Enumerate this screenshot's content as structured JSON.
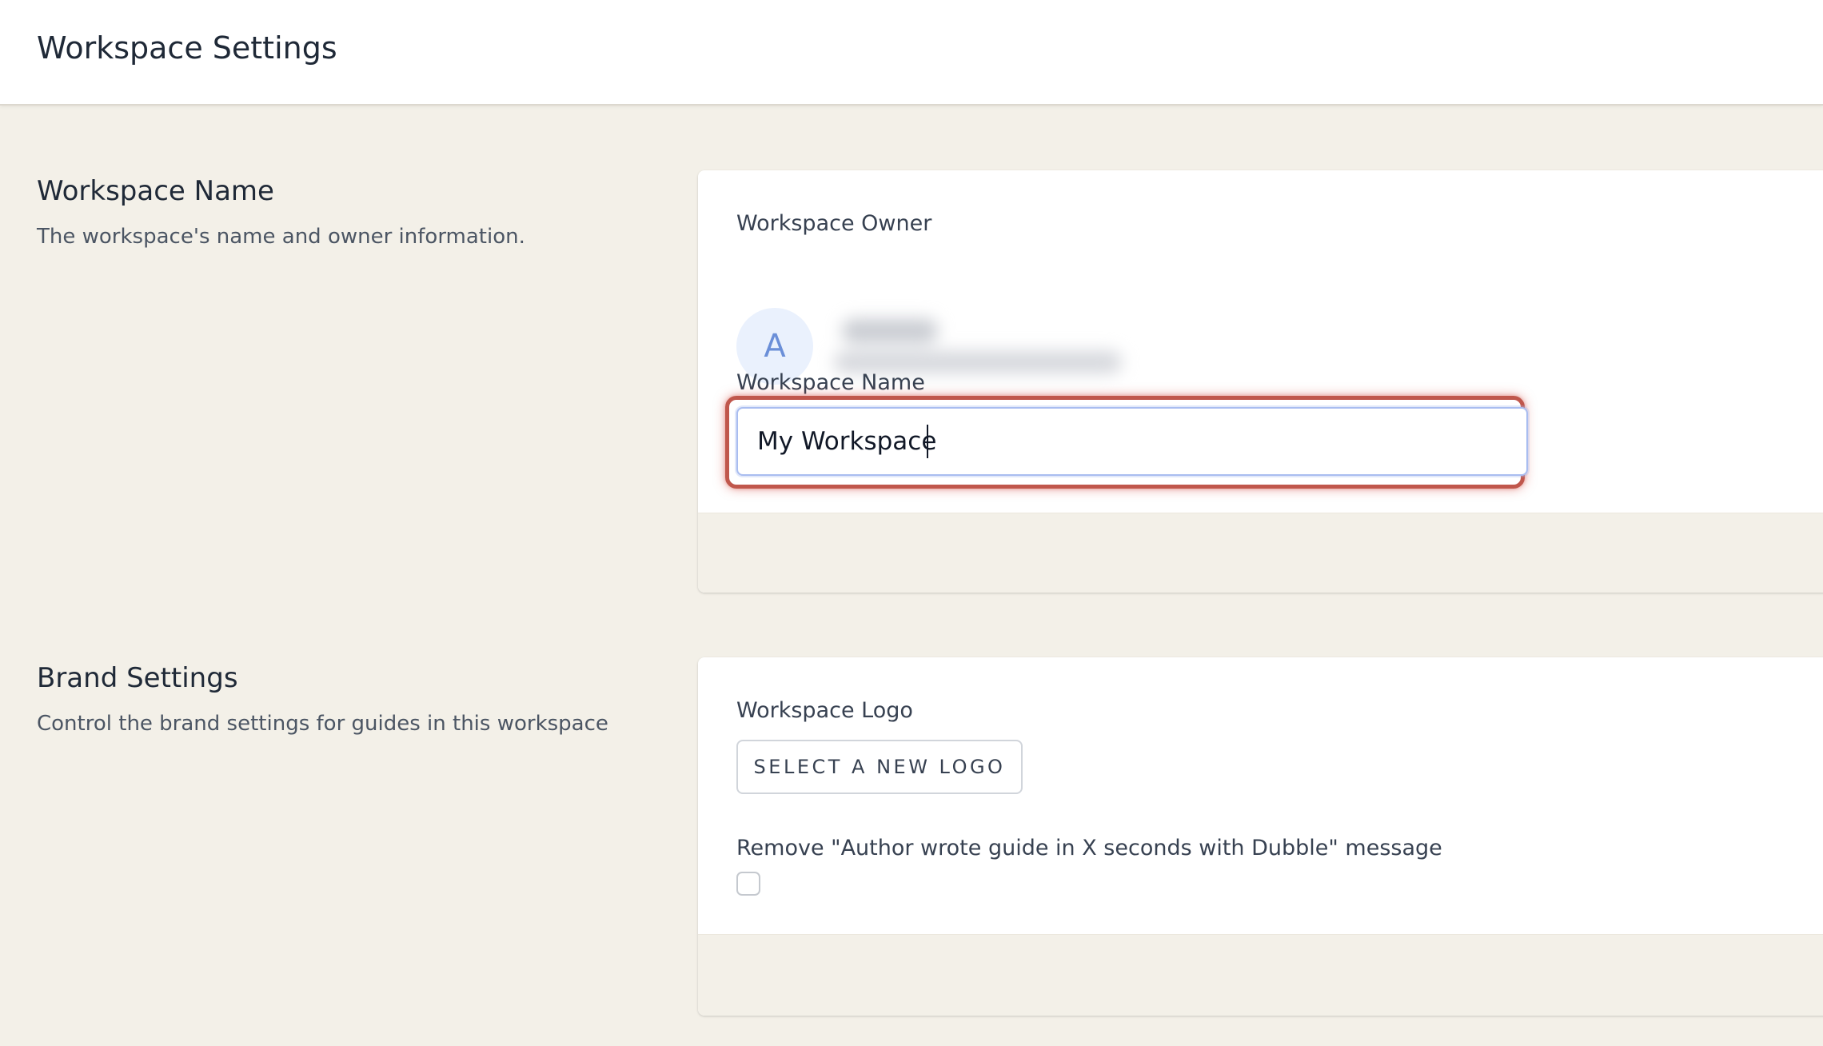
{
  "header": {
    "title": "Workspace Settings"
  },
  "workspace_section": {
    "heading": "Workspace Name",
    "description": "The workspace's name and owner information.",
    "owner_label": "Workspace Owner",
    "owner_avatar_initial": "A",
    "owner_details": "redacted (blurred)",
    "name_label": "Workspace Name",
    "name_value": "My Workspace",
    "focus_color": "#c0574c"
  },
  "brand_section": {
    "heading": "Brand Settings",
    "description": "Control the brand settings for guides in this workspace",
    "logo_label": "Workspace Logo",
    "logo_button": "SELECT A NEW LOGO",
    "remove_message_label": "Remove \"Author wrote guide in X seconds with Dubble\" message",
    "remove_message_checked": false
  },
  "colors": {
    "background": "#f3f0e8",
    "card": "#ffffff",
    "avatar_bg": "#eaf1fd",
    "avatar_text": "#6b8fd8",
    "input_border": "#a9bdf0"
  }
}
